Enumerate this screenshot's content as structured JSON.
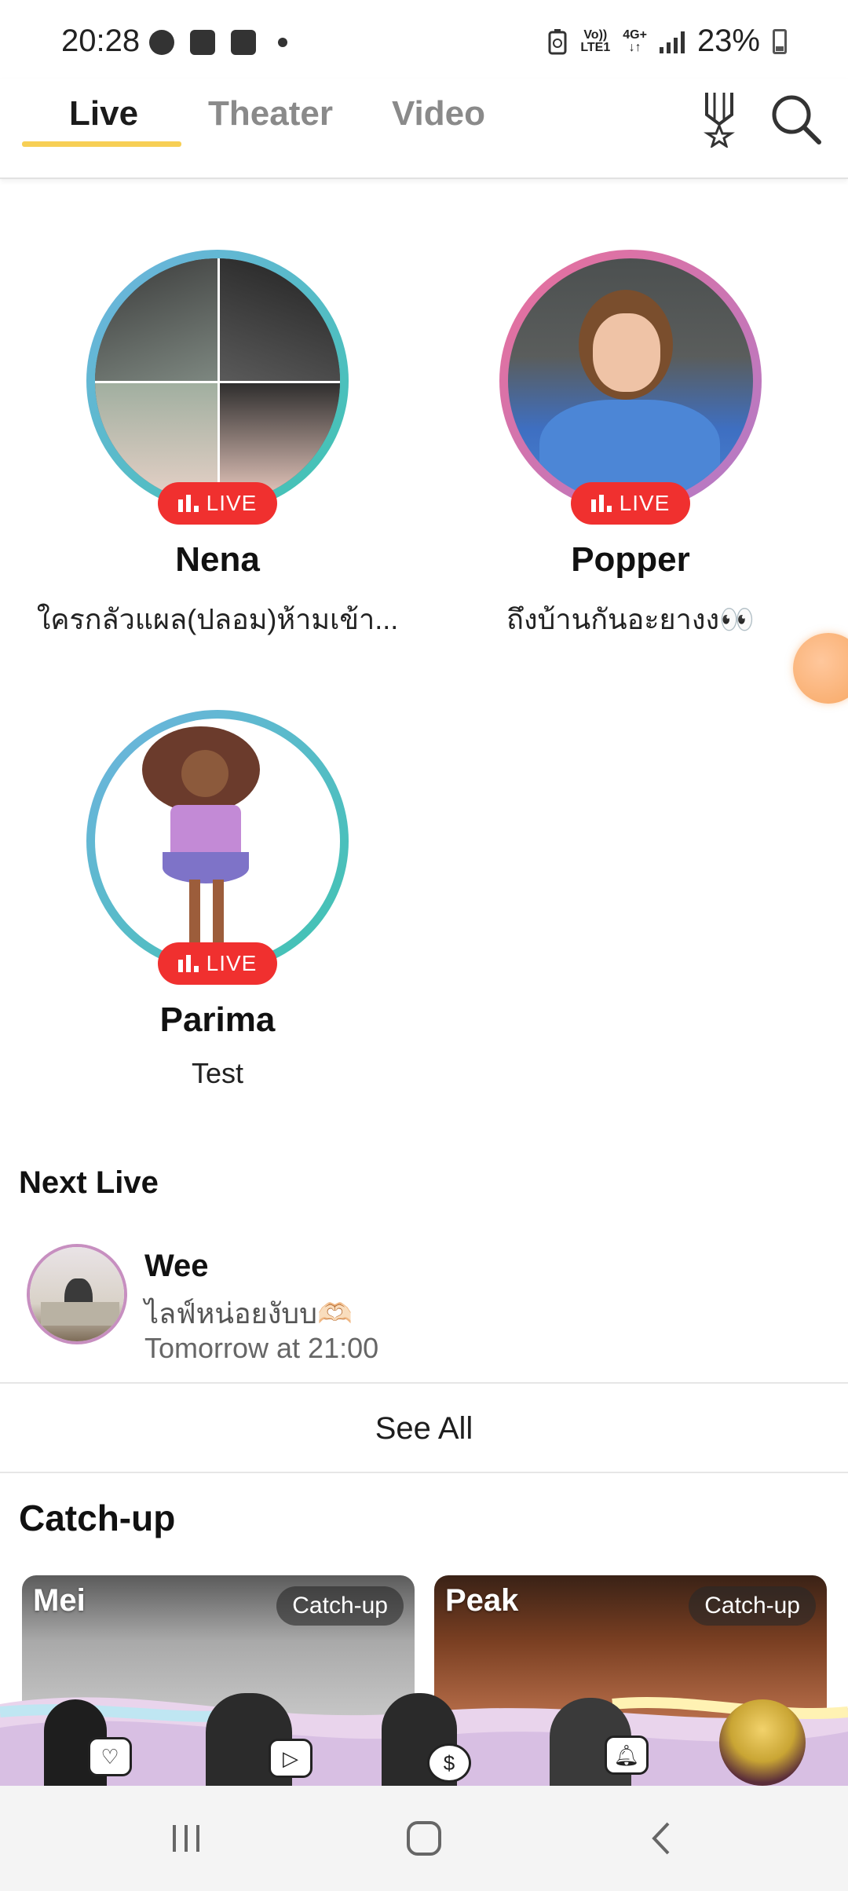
{
  "status_bar": {
    "time": "20:28",
    "network_top": "Vo))",
    "network_bottom": "LTE1",
    "network_type": "4G+",
    "battery": "23%",
    "icons": [
      "facebook-icon",
      "video-icon",
      "gallery-icon",
      "dot-icon",
      "battery-saver-icon",
      "signal-icon",
      "battery-icon"
    ]
  },
  "tabs": [
    {
      "label": "Live",
      "active": true
    },
    {
      "label": "Theater",
      "active": false
    },
    {
      "label": "Video",
      "active": false
    }
  ],
  "header_icons": [
    "ranking-medal-icon",
    "search-icon"
  ],
  "live_badge": "LIVE",
  "live_members": [
    {
      "name": "Nena",
      "desc": "ใครกลัวแผล(ปลอม)ห้ามเข้า..."
    },
    {
      "name": "Popper",
      "desc": "ถึงบ้านกันอะยางง👀"
    },
    {
      "name": "Parima",
      "desc": "Test"
    }
  ],
  "next_live": {
    "title": "Next Live",
    "item": {
      "name": "Wee",
      "desc": "ไลฟ์หน่อยงับบ🫶🏻",
      "time": "Tomorrow at 21:00"
    }
  },
  "see_all": "See All",
  "catch_up": {
    "title": "Catch-up",
    "cards": [
      {
        "name": "Mei",
        "tag": "Catch-up"
      },
      {
        "name": "Peak",
        "tag": "Catch-up"
      }
    ]
  },
  "colors": {
    "accent_underline": "#f7cf55",
    "live_red": "#f0302f",
    "ring_blue_teal": [
      "#6fb3e0",
      "#3fc4b0"
    ],
    "ring_pink_purple": [
      "#ea6f9a",
      "#b07bc9"
    ]
  },
  "nav_icons": [
    "recent-apps-icon",
    "home-icon",
    "back-icon"
  ]
}
